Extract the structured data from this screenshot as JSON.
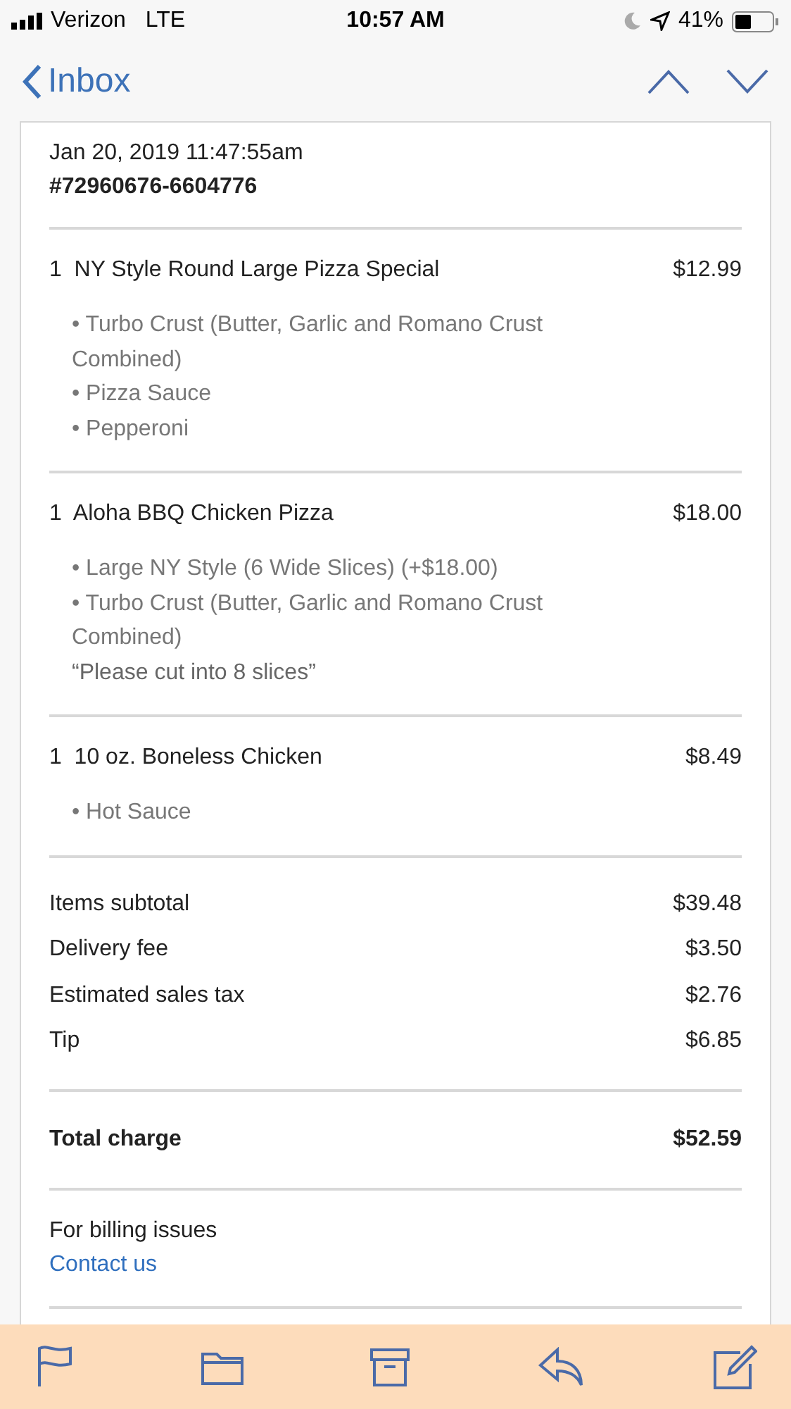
{
  "status_bar": {
    "carrier": "Verizon",
    "network": "LTE",
    "time": "10:57 AM",
    "battery": "41%"
  },
  "nav": {
    "back": "Inbox"
  },
  "order": {
    "date": "Jan 20, 2019 11:47:55am",
    "number": "#72960676-6604776"
  },
  "items": [
    {
      "qty": "1",
      "name": "NY Style Round Large Pizza Special",
      "price": "$12.99",
      "options": [
        {
          "kind": "option",
          "text": "• Turbo Crust (Butter, Garlic and Romano Crust Combined)"
        },
        {
          "kind": "option",
          "text": "• Pizza Sauce"
        },
        {
          "kind": "option",
          "text": "• Pepperoni"
        }
      ]
    },
    {
      "qty": "1",
      "name": "Aloha BBQ Chicken Pizza",
      "price": "$18.00",
      "options": [
        {
          "kind": "option",
          "text": "• Large NY Style (6 Wide Slices) (+$18.00)"
        },
        {
          "kind": "option",
          "text": "• Turbo Crust (Butter, Garlic and Romano Crust Combined)"
        },
        {
          "kind": "note",
          "text": "“Please cut into 8 slices”"
        }
      ]
    },
    {
      "qty": "1",
      "name": "10 oz. Boneless Chicken",
      "price": "$8.49",
      "options": [
        {
          "kind": "option",
          "text": "• Hot Sauce"
        }
      ]
    }
  ],
  "totals": [
    {
      "label": "Items subtotal",
      "value": "$39.48"
    },
    {
      "label": "Delivery fee",
      "value": "$3.50"
    },
    {
      "label": "Estimated sales tax",
      "value": "$2.76"
    },
    {
      "label": "Tip",
      "value": "$6.85"
    }
  ],
  "total": {
    "label": "Total charge",
    "value": "$52.59"
  },
  "billing": {
    "text": "For billing issues",
    "link": "Contact us"
  }
}
